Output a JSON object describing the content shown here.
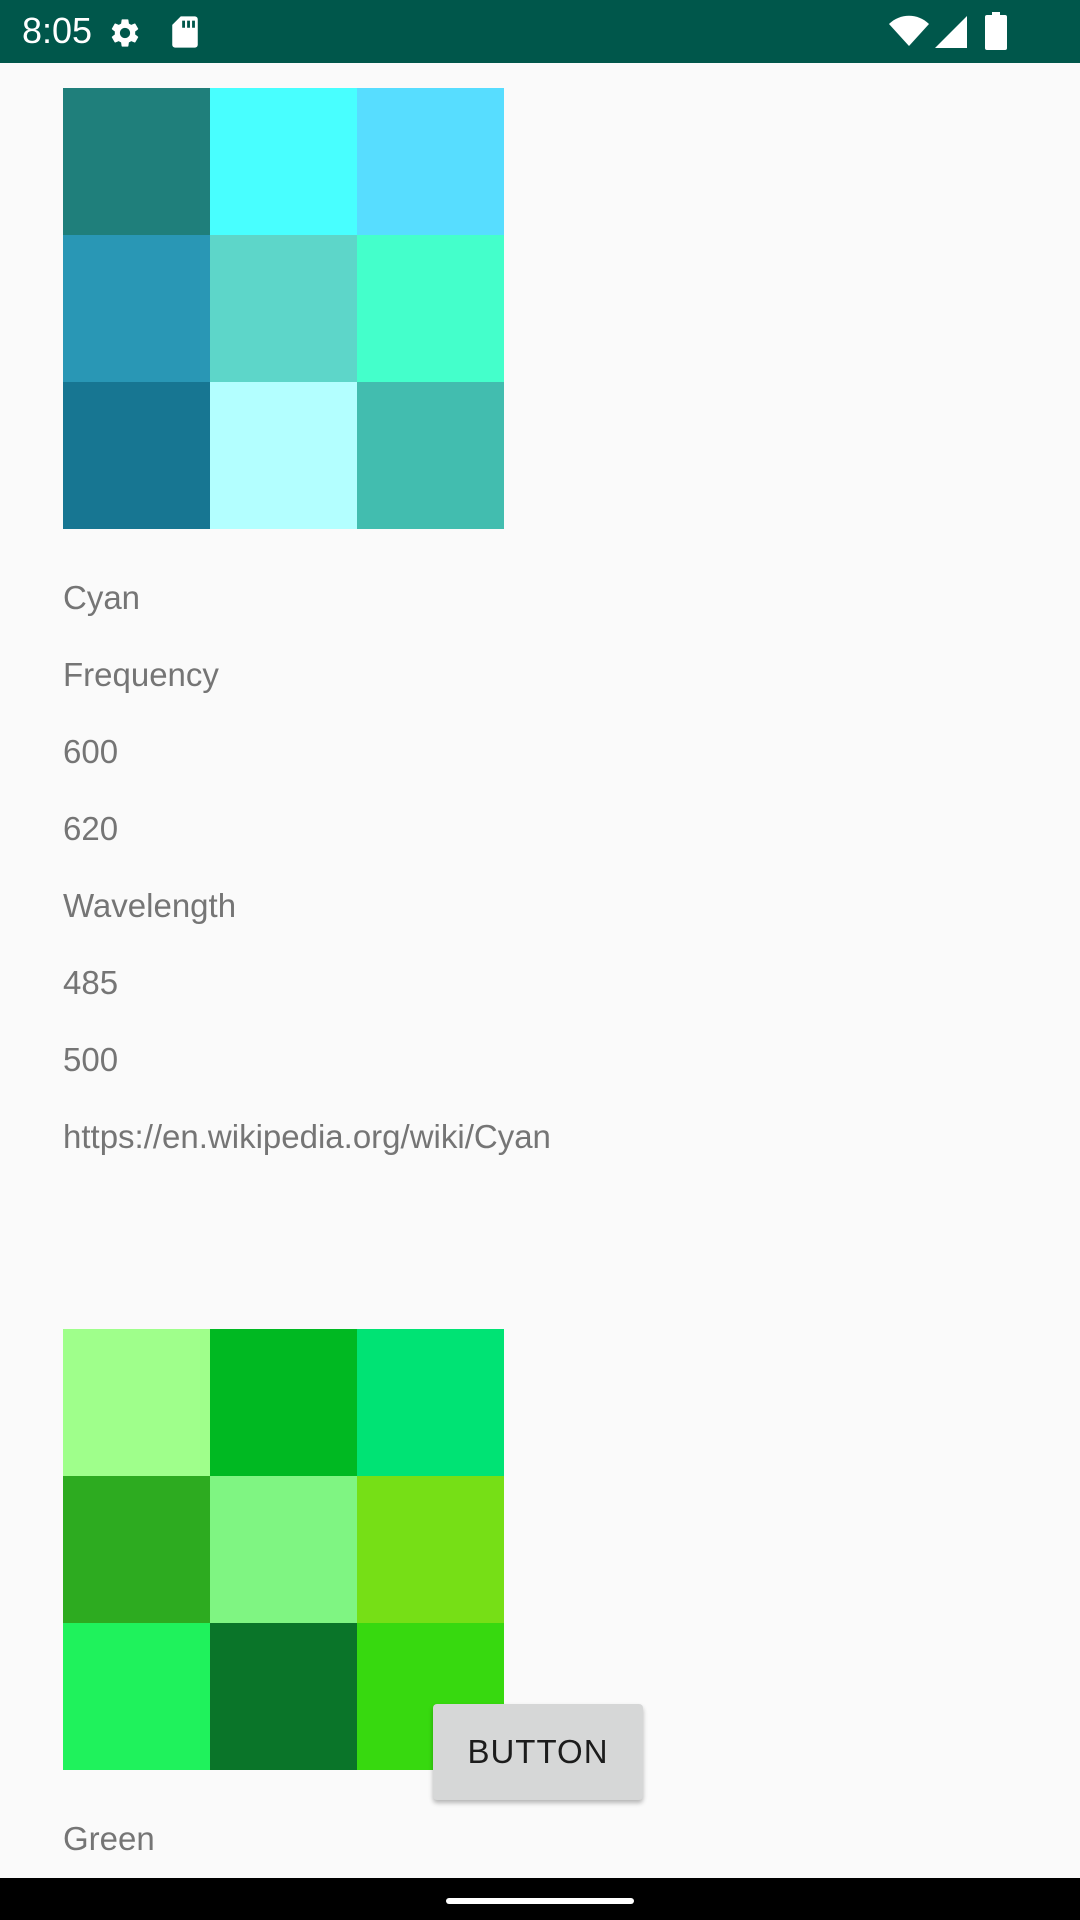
{
  "status_bar": {
    "time": "8:05",
    "icons_left": [
      "settings-icon",
      "sd-card-icon"
    ],
    "icons_right": [
      "wifi-icon",
      "signal-icon",
      "battery-icon"
    ],
    "background": "#00574b"
  },
  "sections": [
    {
      "swatches": [
        "#1f7f7b",
        "#48ffff",
        "#57ddff",
        "#2997b5",
        "#5dd6c9",
        "#44ffcb",
        "#177692",
        "#b3ffff",
        "#42bdaf"
      ],
      "lines": [
        "Cyan",
        "Frequency",
        "600",
        "620",
        "Wavelength",
        "485",
        "500",
        "https://en.wikipedia.org/wiki/Cyan"
      ]
    },
    {
      "swatches": [
        "#9fff8b",
        "#00b922",
        "#00e374",
        "#2dab20",
        "#7ff582",
        "#76df16",
        "#1ff25c",
        "#0a7529",
        "#37d90f"
      ],
      "lines": [
        "Green"
      ]
    }
  ],
  "button": {
    "label": "BUTTON"
  }
}
